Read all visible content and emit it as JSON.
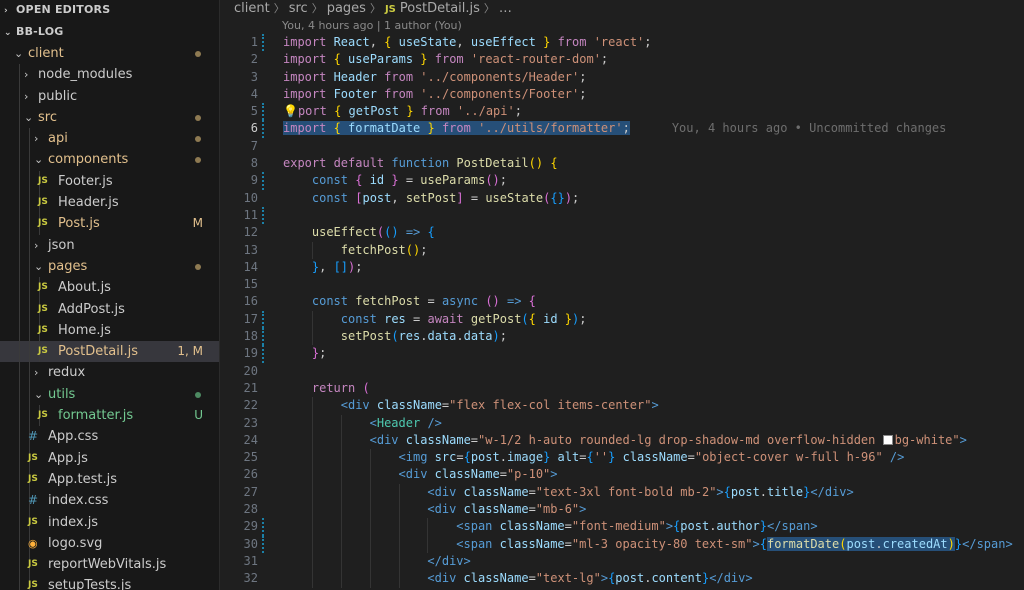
{
  "explorer": {
    "open_editors_label": "OPEN EDITORS",
    "project_label": "BB-LOG",
    "tree": [
      {
        "label": "client",
        "depth": 0,
        "kind": "folder-open",
        "color": "mod",
        "status": "dot"
      },
      {
        "label": "node_modules",
        "depth": 1,
        "kind": "folder-closed"
      },
      {
        "label": "public",
        "depth": 1,
        "kind": "folder-closed"
      },
      {
        "label": "src",
        "depth": 1,
        "kind": "folder-open",
        "color": "mod",
        "status": "dot"
      },
      {
        "label": "api",
        "depth": 2,
        "kind": "folder-closed",
        "color": "mod",
        "status": "dot"
      },
      {
        "label": "components",
        "depth": 2,
        "kind": "folder-open",
        "color": "mod",
        "status": "dot"
      },
      {
        "label": "Footer.js",
        "depth": 3,
        "kind": "js",
        "icon": "JS"
      },
      {
        "label": "Header.js",
        "depth": 3,
        "kind": "js",
        "icon": "JS"
      },
      {
        "label": "Post.js",
        "depth": 3,
        "kind": "js",
        "icon": "JS",
        "color": "mod",
        "badge": "M"
      },
      {
        "label": "json",
        "depth": 2,
        "kind": "folder-closed"
      },
      {
        "label": "pages",
        "depth": 2,
        "kind": "folder-open",
        "color": "mod",
        "status": "dot"
      },
      {
        "label": "About.js",
        "depth": 3,
        "kind": "js",
        "icon": "JS"
      },
      {
        "label": "AddPost.js",
        "depth": 3,
        "kind": "js",
        "icon": "JS"
      },
      {
        "label": "Home.js",
        "depth": 3,
        "kind": "js",
        "icon": "JS"
      },
      {
        "label": "PostDetail.js",
        "depth": 3,
        "kind": "js",
        "icon": "JS",
        "color": "mod",
        "badge": "1, M",
        "selected": true
      },
      {
        "label": "redux",
        "depth": 2,
        "kind": "folder-closed"
      },
      {
        "label": "utils",
        "depth": 2,
        "kind": "folder-open",
        "color": "untracked",
        "status": "dot-u"
      },
      {
        "label": "formatter.js",
        "depth": 3,
        "kind": "js",
        "icon": "JS",
        "color": "untracked",
        "badge": "U"
      },
      {
        "label": "App.css",
        "depth": 2,
        "kind": "css",
        "icon": "#"
      },
      {
        "label": "App.js",
        "depth": 2,
        "kind": "js",
        "icon": "JS"
      },
      {
        "label": "App.test.js",
        "depth": 2,
        "kind": "js",
        "icon": "JS"
      },
      {
        "label": "index.css",
        "depth": 2,
        "kind": "css",
        "icon": "#"
      },
      {
        "label": "index.js",
        "depth": 2,
        "kind": "js",
        "icon": "JS"
      },
      {
        "label": "logo.svg",
        "depth": 2,
        "kind": "svg",
        "icon": "◉"
      },
      {
        "label": "reportWebVitals.js",
        "depth": 2,
        "kind": "js",
        "icon": "JS"
      },
      {
        "label": "setupTests.js",
        "depth": 2,
        "kind": "js",
        "icon": "JS"
      }
    ]
  },
  "breadcrumb": {
    "parts": [
      "client",
      "src",
      "pages"
    ],
    "file_icon": "JS",
    "file": "PostDetail.js",
    "ellipsis": "…"
  },
  "blame_header": "You, 4 hours ago | 1 author (You)",
  "inline_blame": "You, 4 hours ago • Uncommitted changes",
  "active_line": 6,
  "code_lines": [
    {
      "n": 1,
      "indent": 0,
      "mod": true,
      "t": [
        [
          "kw2",
          "import "
        ],
        [
          "var",
          "React"
        ],
        [
          "pun",
          ", "
        ],
        [
          "br1",
          "{ "
        ],
        [
          "var",
          "useState"
        ],
        [
          "pun",
          ", "
        ],
        [
          "var",
          "useEffect"
        ],
        [
          "br1",
          " }"
        ],
        [
          "kw2",
          " from "
        ],
        [
          "str",
          "'react'"
        ],
        [
          "pun",
          ";"
        ]
      ]
    },
    {
      "n": 2,
      "indent": 0,
      "t": [
        [
          "kw2",
          "import "
        ],
        [
          "br1",
          "{ "
        ],
        [
          "var",
          "useParams"
        ],
        [
          "br1",
          " }"
        ],
        [
          "kw2",
          " from "
        ],
        [
          "str",
          "'react-router-dom'"
        ],
        [
          "pun",
          ";"
        ]
      ]
    },
    {
      "n": 3,
      "indent": 0,
      "t": [
        [
          "kw2",
          "import "
        ],
        [
          "var",
          "Header"
        ],
        [
          "kw2",
          " from "
        ],
        [
          "str",
          "'../components/Header'"
        ],
        [
          "pun",
          ";"
        ]
      ]
    },
    {
      "n": 4,
      "indent": 0,
      "t": [
        [
          "kw2",
          "import "
        ],
        [
          "var",
          "Footer"
        ],
        [
          "kw2",
          " from "
        ],
        [
          "str",
          "'../components/Footer'"
        ],
        [
          "pun",
          ";"
        ]
      ]
    },
    {
      "n": 5,
      "indent": 0,
      "mod": true,
      "t": [
        [
          "bulb",
          "💡"
        ],
        [
          "kw2",
          "port "
        ],
        [
          "br1",
          "{ "
        ],
        [
          "var",
          "getPost"
        ],
        [
          "br1",
          " }"
        ],
        [
          "kw2",
          " from "
        ],
        [
          "str",
          "'../api'"
        ],
        [
          "pun",
          ";"
        ]
      ]
    },
    {
      "n": 6,
      "indent": 0,
      "mod": true,
      "hl": true,
      "t": [
        [
          "kw2",
          "import "
        ],
        [
          "br1",
          "{ "
        ],
        [
          "var",
          "formatDate"
        ],
        [
          "br1",
          " }"
        ],
        [
          "kw2",
          " from "
        ],
        [
          "str",
          "'../utils/formatter'"
        ],
        [
          "pun",
          ";"
        ]
      ]
    },
    {
      "n": 7,
      "indent": 0,
      "t": []
    },
    {
      "n": 8,
      "indent": 0,
      "t": [
        [
          "kw2",
          "export "
        ],
        [
          "kw2",
          "default "
        ],
        [
          "kw",
          "function "
        ],
        [
          "fn",
          "PostDetail"
        ],
        [
          "br1",
          "() {"
        ]
      ]
    },
    {
      "n": 9,
      "indent": 1,
      "mod": true,
      "t": [
        [
          "kw",
          "const "
        ],
        [
          "br2",
          "{ "
        ],
        [
          "var",
          "id"
        ],
        [
          "br2",
          " }"
        ],
        [
          "pun",
          " = "
        ],
        [
          "fn",
          "useParams"
        ],
        [
          "br2",
          "()"
        ],
        [
          "pun",
          ";"
        ]
      ]
    },
    {
      "n": 10,
      "indent": 1,
      "t": [
        [
          "kw",
          "const "
        ],
        [
          "br2",
          "["
        ],
        [
          "var",
          "post"
        ],
        [
          "pun",
          ", "
        ],
        [
          "fn",
          "setPost"
        ],
        [
          "br2",
          "]"
        ],
        [
          "pun",
          " = "
        ],
        [
          "fn",
          "useState"
        ],
        [
          "br2",
          "("
        ],
        [
          "br3",
          "{}"
        ],
        [
          "br2",
          ")"
        ],
        [
          "pun",
          ";"
        ]
      ]
    },
    {
      "n": 11,
      "indent": 1,
      "mod": true,
      "t": []
    },
    {
      "n": 12,
      "indent": 1,
      "t": [
        [
          "fn",
          "useEffect"
        ],
        [
          "br2",
          "("
        ],
        [
          "br3",
          "()"
        ],
        [
          "kw",
          " => "
        ],
        [
          "br3",
          "{"
        ]
      ]
    },
    {
      "n": 13,
      "indent": 2,
      "t": [
        [
          "fn",
          "fetchPost"
        ],
        [
          "br1",
          "()"
        ],
        [
          "pun",
          ";"
        ]
      ]
    },
    {
      "n": 14,
      "indent": 1,
      "t": [
        [
          "br3",
          "}"
        ],
        [
          "pun",
          ", "
        ],
        [
          "br3",
          "[]"
        ],
        [
          "br2",
          ")"
        ],
        [
          "pun",
          ";"
        ]
      ]
    },
    {
      "n": 15,
      "indent": 1,
      "t": []
    },
    {
      "n": 16,
      "indent": 1,
      "t": [
        [
          "kw",
          "const "
        ],
        [
          "fn",
          "fetchPost"
        ],
        [
          "pun",
          " = "
        ],
        [
          "kw",
          "async "
        ],
        [
          "br2",
          "()"
        ],
        [
          "kw",
          " => "
        ],
        [
          "br2",
          "{"
        ]
      ]
    },
    {
      "n": 17,
      "indent": 2,
      "mod": true,
      "t": [
        [
          "kw",
          "const "
        ],
        [
          "var",
          "res"
        ],
        [
          "pun",
          " = "
        ],
        [
          "kw2",
          "await "
        ],
        [
          "fn",
          "getPost"
        ],
        [
          "br3",
          "("
        ],
        [
          "br1",
          "{ "
        ],
        [
          "var",
          "id"
        ],
        [
          "br1",
          " }"
        ],
        [
          "br3",
          ")"
        ],
        [
          "pun",
          ";"
        ]
      ]
    },
    {
      "n": 18,
      "indent": 2,
      "mod": true,
      "t": [
        [
          "fn",
          "setPost"
        ],
        [
          "br3",
          "("
        ],
        [
          "var",
          "res"
        ],
        [
          "pun",
          "."
        ],
        [
          "var",
          "data"
        ],
        [
          "pun",
          "."
        ],
        [
          "var",
          "data"
        ],
        [
          "br3",
          ")"
        ],
        [
          "pun",
          ";"
        ]
      ]
    },
    {
      "n": 19,
      "indent": 1,
      "mod": true,
      "t": [
        [
          "br2",
          "}"
        ],
        [
          "pun",
          ";"
        ]
      ]
    },
    {
      "n": 20,
      "indent": 1,
      "t": []
    },
    {
      "n": 21,
      "indent": 1,
      "t": [
        [
          "kw2",
          "return "
        ],
        [
          "br2",
          "("
        ]
      ]
    },
    {
      "n": 22,
      "indent": 2,
      "t": [
        [
          "tag",
          "<"
        ],
        [
          "tag",
          "div "
        ],
        [
          "attr",
          "className"
        ],
        [
          "pun",
          "="
        ],
        [
          "str",
          "\"flex flex-col items-center\""
        ],
        [
          "tag",
          ">"
        ]
      ]
    },
    {
      "n": 23,
      "indent": 3,
      "t": [
        [
          "tag",
          "<"
        ],
        [
          "cmp",
          "Header "
        ],
        [
          "tag",
          "/>"
        ]
      ]
    },
    {
      "n": 24,
      "indent": 3,
      "t": [
        [
          "tag",
          "<"
        ],
        [
          "tag",
          "div "
        ],
        [
          "attr",
          "className"
        ],
        [
          "pun",
          "="
        ],
        [
          "str",
          "\"w-1/2 h-auto rounded-lg drop-shadow-md overflow-hidden "
        ],
        [
          "swatch",
          ""
        ],
        [
          "str",
          "bg-white\""
        ],
        [
          "tag",
          ">"
        ]
      ]
    },
    {
      "n": 25,
      "indent": 4,
      "t": [
        [
          "tag",
          "<"
        ],
        [
          "tag",
          "img "
        ],
        [
          "attr",
          "src"
        ],
        [
          "pun",
          "="
        ],
        [
          "br3",
          "{"
        ],
        [
          "var",
          "post"
        ],
        [
          "pun",
          "."
        ],
        [
          "var",
          "image"
        ],
        [
          "br3",
          "}"
        ],
        [
          "attr",
          " alt"
        ],
        [
          "pun",
          "="
        ],
        [
          "br3",
          "{"
        ],
        [
          "str",
          "''"
        ],
        [
          "br3",
          "}"
        ],
        [
          "attr",
          " className"
        ],
        [
          "pun",
          "="
        ],
        [
          "str",
          "\"object-cover w-full h-96\""
        ],
        [
          "tag",
          " />"
        ]
      ]
    },
    {
      "n": 26,
      "indent": 4,
      "t": [
        [
          "tag",
          "<"
        ],
        [
          "tag",
          "div "
        ],
        [
          "attr",
          "className"
        ],
        [
          "pun",
          "="
        ],
        [
          "str",
          "\"p-10\""
        ],
        [
          "tag",
          ">"
        ]
      ]
    },
    {
      "n": 27,
      "indent": 5,
      "t": [
        [
          "tag",
          "<"
        ],
        [
          "tag",
          "div "
        ],
        [
          "attr",
          "className"
        ],
        [
          "pun",
          "="
        ],
        [
          "str",
          "\"text-3xl font-bold mb-2\""
        ],
        [
          "tag",
          ">"
        ],
        [
          "br3",
          "{"
        ],
        [
          "var",
          "post"
        ],
        [
          "pun",
          "."
        ],
        [
          "var",
          "title"
        ],
        [
          "br3",
          "}"
        ],
        [
          "tag",
          "</"
        ],
        [
          "tag",
          "div"
        ],
        [
          "tag",
          ">"
        ]
      ]
    },
    {
      "n": 28,
      "indent": 5,
      "t": [
        [
          "tag",
          "<"
        ],
        [
          "tag",
          "div "
        ],
        [
          "attr",
          "className"
        ],
        [
          "pun",
          "="
        ],
        [
          "str",
          "\"mb-6\""
        ],
        [
          "tag",
          ">"
        ]
      ]
    },
    {
      "n": 29,
      "indent": 6,
      "mod": true,
      "t": [
        [
          "tag",
          "<"
        ],
        [
          "tag",
          "span "
        ],
        [
          "attr",
          "className"
        ],
        [
          "pun",
          "="
        ],
        [
          "str",
          "\"font-medium\""
        ],
        [
          "tag",
          ">"
        ],
        [
          "br3",
          "{"
        ],
        [
          "var",
          "post"
        ],
        [
          "pun",
          "."
        ],
        [
          "var",
          "author"
        ],
        [
          "br3",
          "}"
        ],
        [
          "tag",
          "</"
        ],
        [
          "tag",
          "span"
        ],
        [
          "tag",
          ">"
        ]
      ]
    },
    {
      "n": 30,
      "indent": 6,
      "mod": true,
      "t": [
        [
          "tag",
          "<"
        ],
        [
          "tag",
          "span "
        ],
        [
          "attr",
          "className"
        ],
        [
          "pun",
          "="
        ],
        [
          "str",
          "\"ml-3 opacity-80 text-sm\""
        ],
        [
          "tag",
          ">"
        ],
        [
          "br3",
          "{"
        ],
        [
          "fnhl",
          "formatDate"
        ],
        [
          "br1hl",
          "("
        ],
        [
          "varhl",
          "post"
        ],
        [
          "punhl",
          "."
        ],
        [
          "varhl",
          "createdAt"
        ],
        [
          "br1hl",
          ")"
        ],
        [
          "br3",
          "}"
        ],
        [
          "tag",
          "</"
        ],
        [
          "tag",
          "span"
        ],
        [
          "tag",
          ">"
        ]
      ]
    },
    {
      "n": 31,
      "indent": 5,
      "t": [
        [
          "tag",
          "</"
        ],
        [
          "tag",
          "div"
        ],
        [
          "tag",
          ">"
        ]
      ]
    },
    {
      "n": 32,
      "indent": 5,
      "t": [
        [
          "tag",
          "<"
        ],
        [
          "tag",
          "div "
        ],
        [
          "attr",
          "className"
        ],
        [
          "pun",
          "="
        ],
        [
          "str",
          "\"text-lg\""
        ],
        [
          "tag",
          ">"
        ],
        [
          "br3",
          "{"
        ],
        [
          "var",
          "post"
        ],
        [
          "pun",
          "."
        ],
        [
          "var",
          "content"
        ],
        [
          "br3",
          "}"
        ],
        [
          "tag",
          "</"
        ],
        [
          "tag",
          "div"
        ],
        [
          "tag",
          ">"
        ]
      ]
    }
  ]
}
